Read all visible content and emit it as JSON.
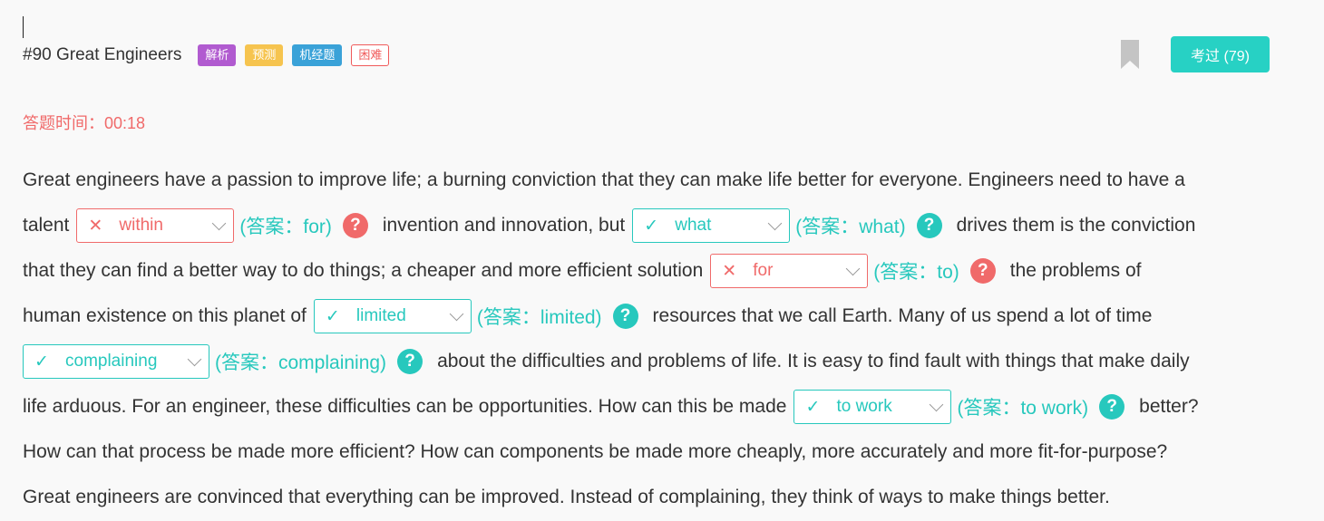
{
  "header": {
    "title": "#90 Great Engineers",
    "tags": [
      "解析",
      "预测",
      "机经题",
      "困难"
    ],
    "taken_button": "考过 (79)"
  },
  "timer": {
    "label": "答题时间：",
    "value": "00:18"
  },
  "passage": {
    "line1": "Great engineers have a passion to improve life; a burning conviction that they can make life better for everyone. Engineers need to have a",
    "line2_a": "talent",
    "line2_b": "invention and innovation, but",
    "line2_c": "drives them is the conviction",
    "line3_a": "that they can find a better way to do things; a cheaper and more efficient solution",
    "line3_b": "the problems of",
    "line4_a": "human existence on this planet of",
    "line4_b": "resources that we call Earth. Many of us spend a lot of time",
    "line5_a": "about the difficulties and problems of life. It is easy to find fault with things that make daily",
    "line6_a": "life arduous. For an engineer, these difficulties can be opportunities. How can this be made",
    "line6_b": "better?",
    "line7": "How can that process be made more efficient? How can components be made more cheaply, more accurately and more fit-for-purpose?",
    "line8": "Great engineers are convinced that everything can be improved. Instead of complaining, they think of ways to make things better."
  },
  "blanks": [
    {
      "selected": "within",
      "mark": "✕",
      "answer": "(答案：for)",
      "status": "wrong"
    },
    {
      "selected": "what",
      "mark": "✓",
      "answer": "(答案：what)",
      "status": "correct"
    },
    {
      "selected": "for",
      "mark": "✕",
      "answer": "(答案：to)",
      "status": "wrong"
    },
    {
      "selected": "limited",
      "mark": "✓",
      "answer": "(答案：limited)",
      "status": "correct"
    },
    {
      "selected": "complaining",
      "mark": "✓",
      "answer": "(答案：complaining)",
      "status": "correct"
    },
    {
      "selected": "to work",
      "mark": "✓",
      "answer": "(答案：to work)",
      "status": "correct"
    }
  ],
  "help_glyph": "?",
  "colors": {
    "teal": "#27c8bd",
    "red": "#f06a6a",
    "purple": "#b15bd0",
    "yellow": "#f6c44f",
    "blue": "#3aa2d8"
  },
  "icons": [
    "bookmark-icon",
    "chevron-down-icon",
    "help-icon",
    "check-icon",
    "cross-icon"
  ]
}
